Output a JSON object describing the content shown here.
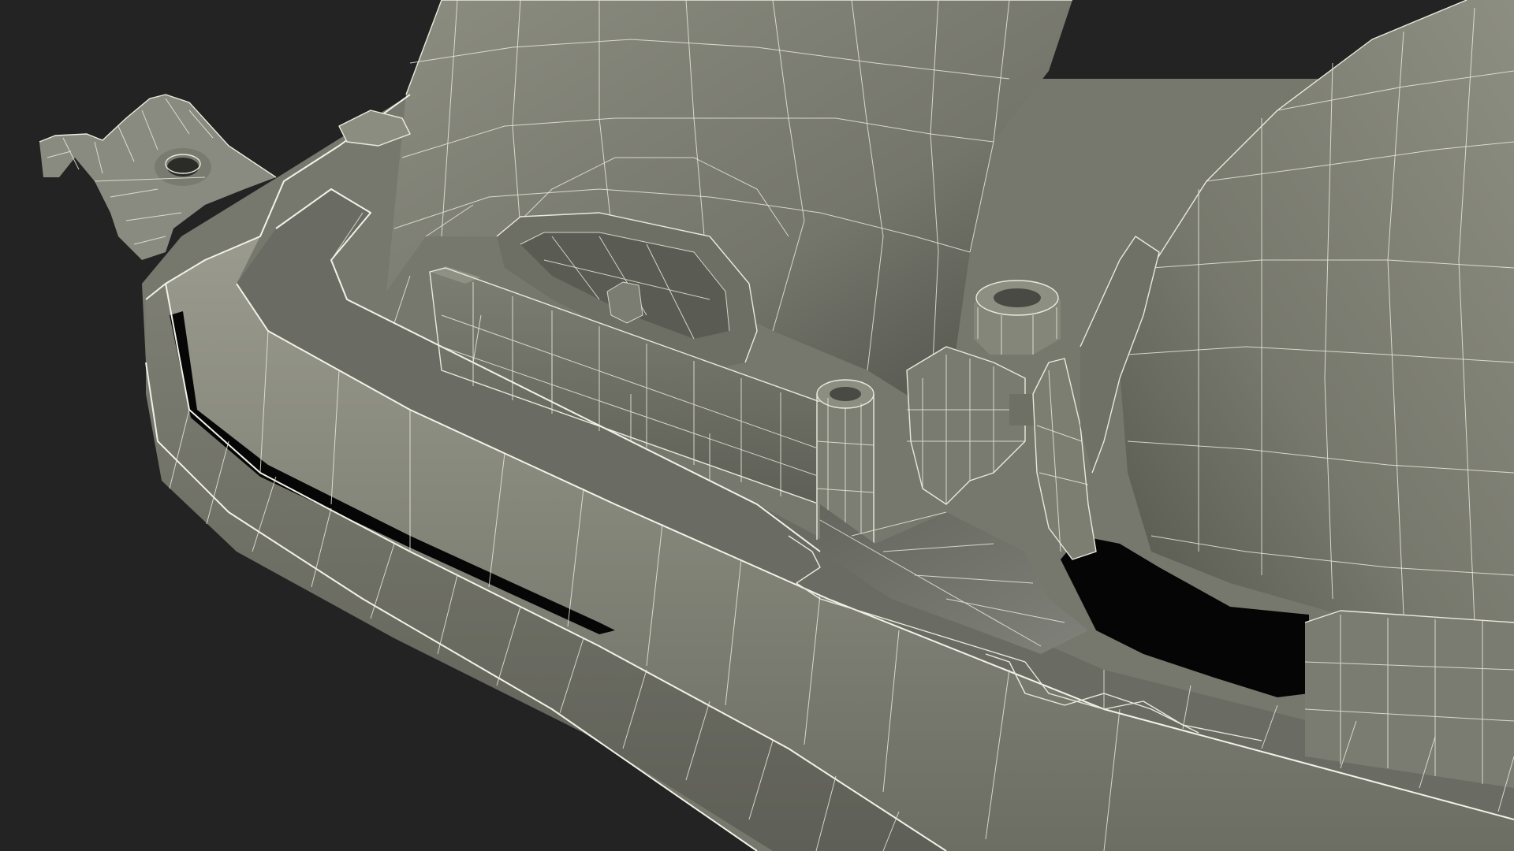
{
  "scene": {
    "subject": "wireframe-3d-model-render",
    "colors": {
      "background": "#232323",
      "surface_light": "#8a8b7f",
      "surface_mid": "#6f7066",
      "surface_dark": "#4d4e46",
      "cavity": "#050505",
      "wire": "#e9e9dc"
    }
  }
}
